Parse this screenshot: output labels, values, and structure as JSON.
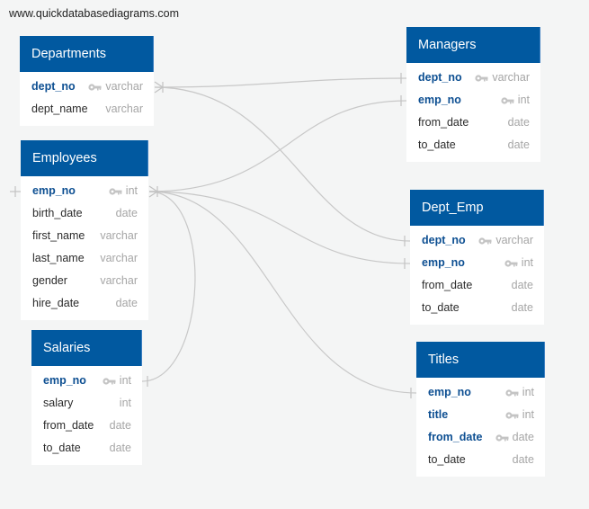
{
  "watermark": "www.quickdatabasediagrams.com",
  "colors": {
    "header_bg": "#0159a0",
    "header_text": "#ffffff",
    "pk_text": "#0d4f92",
    "field_text": "#2b2b2b",
    "type_text": "#a6a6a6",
    "relation_line": "#c8c8c8",
    "canvas_bg": "#f4f5f5"
  },
  "tables": {
    "departments": {
      "name": "Departments",
      "fields": [
        {
          "name": "dept_no",
          "type": "varchar",
          "pk": true,
          "icon": "key-icon"
        },
        {
          "name": "dept_name",
          "type": "varchar",
          "pk": false
        }
      ]
    },
    "employees": {
      "name": "Employees",
      "fields": [
        {
          "name": "emp_no",
          "type": "int",
          "pk": true,
          "icon": "key-icon"
        },
        {
          "name": "birth_date",
          "type": "date",
          "pk": false
        },
        {
          "name": "first_name",
          "type": "varchar",
          "pk": false
        },
        {
          "name": "last_name",
          "type": "varchar",
          "pk": false
        },
        {
          "name": "gender",
          "type": "varchar",
          "pk": false
        },
        {
          "name": "hire_date",
          "type": "date",
          "pk": false
        }
      ]
    },
    "salaries": {
      "name": "Salaries",
      "fields": [
        {
          "name": "emp_no",
          "type": "int",
          "pk": true,
          "icon": "key-icon"
        },
        {
          "name": "salary",
          "type": "int",
          "pk": false
        },
        {
          "name": "from_date",
          "type": "date",
          "pk": false
        },
        {
          "name": "to_date",
          "type": "date",
          "pk": false
        }
      ]
    },
    "managers": {
      "name": "Managers",
      "fields": [
        {
          "name": "dept_no",
          "type": "varchar",
          "pk": true,
          "icon": "key-icon"
        },
        {
          "name": "emp_no",
          "type": "int",
          "pk": true,
          "icon": "key-icon"
        },
        {
          "name": "from_date",
          "type": "date",
          "pk": false
        },
        {
          "name": "to_date",
          "type": "date",
          "pk": false
        }
      ]
    },
    "dept_emp": {
      "name": "Dept_Emp",
      "fields": [
        {
          "name": "dept_no",
          "type": "varchar",
          "pk": true,
          "icon": "key-icon"
        },
        {
          "name": "emp_no",
          "type": "int",
          "pk": true,
          "icon": "key-icon"
        },
        {
          "name": "from_date",
          "type": "date",
          "pk": false
        },
        {
          "name": "to_date",
          "type": "date",
          "pk": false
        }
      ]
    },
    "titles": {
      "name": "Titles",
      "fields": [
        {
          "name": "emp_no",
          "type": "int",
          "pk": true,
          "icon": "key-icon"
        },
        {
          "name": "title",
          "type": "int",
          "pk": true,
          "icon": "key-icon"
        },
        {
          "name": "from_date",
          "type": "date",
          "pk": true,
          "icon": "key-icon"
        },
        {
          "name": "to_date",
          "type": "date",
          "pk": false
        }
      ]
    }
  },
  "relationships": [
    {
      "from": "departments.dept_no",
      "to": "managers.dept_no",
      "from_cardinality": "many",
      "to_cardinality": "one"
    },
    {
      "from": "departments.dept_no",
      "to": "dept_emp.dept_no",
      "from_cardinality": "many",
      "to_cardinality": "one"
    },
    {
      "from": "employees.emp_no",
      "to": "managers.emp_no",
      "from_cardinality": "many",
      "to_cardinality": "one"
    },
    {
      "from": "employees.emp_no",
      "to": "dept_emp.emp_no",
      "from_cardinality": "many",
      "to_cardinality": "one"
    },
    {
      "from": "employees.emp_no",
      "to": "titles.emp_no",
      "from_cardinality": "many",
      "to_cardinality": "one"
    },
    {
      "from": "employees.emp_no",
      "to": "salaries.emp_no",
      "from_cardinality": "many",
      "to_cardinality": "one"
    }
  ]
}
